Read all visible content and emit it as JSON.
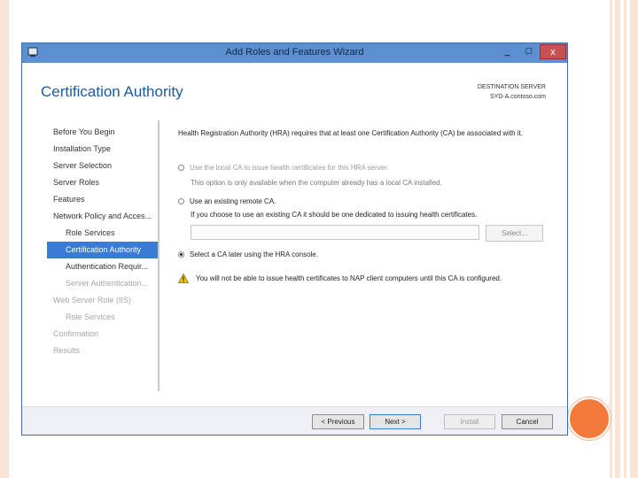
{
  "window": {
    "title": "Add Roles and Features Wizard",
    "minimize": "_",
    "maximize": "□",
    "close": "x"
  },
  "header": {
    "page_title": "Certification Authority",
    "destination_label": "DESTINATION SERVER",
    "destination_server": "SYD-A.contoso.com"
  },
  "nav": {
    "items": [
      {
        "label": "Before You Begin"
      },
      {
        "label": "Installation Type"
      },
      {
        "label": "Server Selection"
      },
      {
        "label": "Server Roles"
      },
      {
        "label": "Features"
      },
      {
        "label": "Network Policy and Acces..."
      },
      {
        "label": "Role Services"
      },
      {
        "label": "Certification Authority"
      },
      {
        "label": "Authentication Requir..."
      },
      {
        "label": "Server Authentication..."
      },
      {
        "label": "Web Server Role (IIS)"
      },
      {
        "label": "Role Services"
      },
      {
        "label": "Confirmation"
      },
      {
        "label": "Results"
      }
    ]
  },
  "content": {
    "intro": "Health Registration Authority (HRA) requires that at least one Certification Authority (CA) be associated with it.",
    "option_local": "Use the local CA to issue health certificates for this HRA server.",
    "option_local_hint": "This option is only available when the computer already has a local CA installed.",
    "option_remote": "Use an existing remote CA.",
    "option_remote_hint": "If you choose to use an existing CA it should be one dedicated to issuing health certificates.",
    "ca_field_value": "",
    "select_button": "Select...",
    "option_later": "Select a CA later using the HRA console.",
    "warning": "You will not be able to issue health certificates to NAP client computers until this CA is configured."
  },
  "footer": {
    "previous": "< Previous",
    "next": "Next >",
    "install": "Install",
    "cancel": "Cancel"
  },
  "colors": {
    "accent": "#3a7bd5",
    "title_blue": "#1c5aa0",
    "slide_orange": "#f37a3b"
  }
}
